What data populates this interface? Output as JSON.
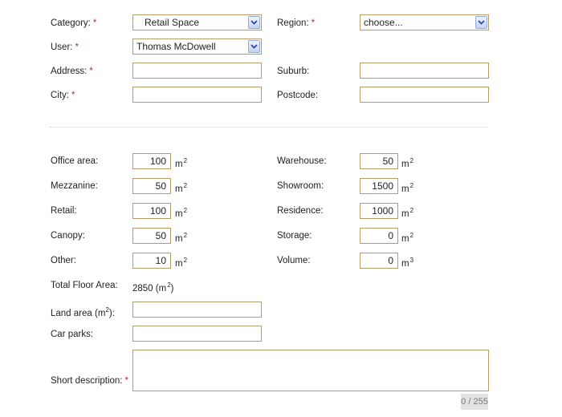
{
  "form": {
    "required_marker": "*",
    "category": {
      "label": "Category:",
      "value": "Retail Space"
    },
    "region": {
      "label": "Region:",
      "value": "choose..."
    },
    "user": {
      "label": "User:",
      "value": "Thomas McDowell"
    },
    "address": {
      "label": "Address:",
      "value": ""
    },
    "suburb": {
      "label": "Suburb:",
      "value": ""
    },
    "city": {
      "label": "City:",
      "value": ""
    },
    "postcode": {
      "label": "Postcode:",
      "value": ""
    },
    "office_area": {
      "label": "Office area:",
      "value": "100",
      "unit": "m",
      "exp": "2"
    },
    "warehouse": {
      "label": "Warehouse:",
      "value": "50",
      "unit": "m",
      "exp": "2"
    },
    "mezzanine": {
      "label": "Mezzanine:",
      "value": "50",
      "unit": "m",
      "exp": "2"
    },
    "showroom": {
      "label": "Showroom:",
      "value": "1500",
      "unit": "m",
      "exp": "2"
    },
    "retail": {
      "label": "Retail:",
      "value": "100",
      "unit": "m",
      "exp": "2"
    },
    "residence": {
      "label": "Residence:",
      "value": "1000",
      "unit": "m",
      "exp": "2"
    },
    "canopy": {
      "label": "Canopy:",
      "value": "50",
      "unit": "m",
      "exp": "2"
    },
    "storage": {
      "label": "Storage:",
      "value": "0",
      "unit": "m",
      "exp": "2"
    },
    "other": {
      "label": "Other:",
      "value": "10",
      "unit": "m",
      "exp": "2"
    },
    "volume": {
      "label": "Volume:",
      "value": "0",
      "unit": "m",
      "exp": "3"
    },
    "total_floor_area": {
      "label": "Total Floor Area:",
      "value": "2850",
      "unit_open": "(m",
      "exp": "2",
      "unit_close": ")"
    },
    "land_area": {
      "label_prefix": "Land area (m",
      "label_exp": "2",
      "label_suffix": "):",
      "value": ""
    },
    "car_parks": {
      "label": "Car parks:",
      "value": ""
    },
    "short_description": {
      "label": "Short description:",
      "value": "",
      "counter": "0 / 255"
    }
  },
  "colors": {
    "field_border": "#b59d6a",
    "required": "#cc2222",
    "dropdown_button": "#c3d3f5"
  }
}
